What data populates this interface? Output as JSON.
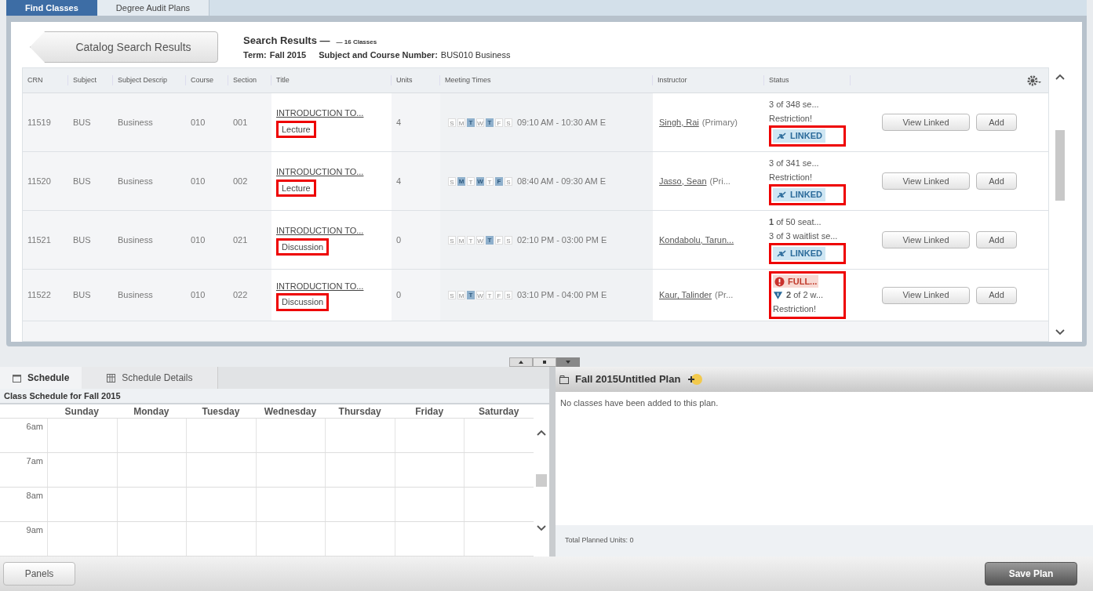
{
  "top_tabs": [
    {
      "label": "Find Classes",
      "selected": true
    },
    {
      "label": "Degree Audit Plans",
      "selected": false
    }
  ],
  "back_button": "Catalog Search Results",
  "results": {
    "title": "Search Results —",
    "count": "— 16 Classes",
    "term_label": "Term:",
    "term": "Fall 2015",
    "subject_label": "Subject and Course Number:",
    "subject": "BUS010 Business"
  },
  "table": {
    "columns": [
      "CRN",
      "Subject",
      "Subject Descrip",
      "Course",
      "Section",
      "Title",
      "Units",
      "Meeting Times",
      "Instructor",
      "Status"
    ],
    "rows": [
      {
        "crn": "11519",
        "subject": "BUS",
        "description": "Business",
        "course": "010",
        "section": "001",
        "title": "INTRODUCTION TO...",
        "type": {
          "text": "Lecture",
          "boxed": true
        },
        "units": "4",
        "days": [
          {
            "letter": "S",
            "selected": false
          },
          {
            "letter": "M",
            "selected": false
          },
          {
            "letter": "T",
            "selected": true
          },
          {
            "letter": "W",
            "selected": false
          },
          {
            "letter": "T",
            "selected": true
          },
          {
            "letter": "F",
            "selected": false
          },
          {
            "letter": "S",
            "selected": false
          }
        ],
        "time": "09:10 AM - 10:30 AM E",
        "instructor": "Singh, Rai",
        "instructor_role": "(Primary)",
        "status": {
          "plain": [
            {
              "kind": "text",
              "text": "3 of 348 se..."
            },
            {
              "kind": "text",
              "text": "Restriction!"
            }
          ],
          "boxed": [
            {
              "kind": "linked",
              "text": "LINKED"
            }
          ]
        },
        "actions": [
          "View Linked",
          "Add"
        ]
      },
      {
        "crn": "11520",
        "subject": "BUS",
        "description": "Business",
        "course": "010",
        "section": "002",
        "title": "INTRODUCTION TO...",
        "type": {
          "text": "Lecture",
          "boxed": true
        },
        "units": "4",
        "days": [
          {
            "letter": "S",
            "selected": false
          },
          {
            "letter": "M",
            "selected": true
          },
          {
            "letter": "T",
            "selected": false
          },
          {
            "letter": "W",
            "selected": true
          },
          {
            "letter": "T",
            "selected": false
          },
          {
            "letter": "F",
            "selected": true
          },
          {
            "letter": "S",
            "selected": false
          }
        ],
        "time": "08:40 AM - 09:30 AM E",
        "instructor": "Jasso, Sean",
        "instructor_role": "(Pri...",
        "status": {
          "plain": [
            {
              "kind": "text",
              "text": "3 of 341 se..."
            },
            {
              "kind": "text",
              "text": "Restriction!"
            }
          ],
          "boxed": [
            {
              "kind": "linked",
              "text": "LINKED"
            }
          ]
        },
        "actions": [
          "View Linked",
          "Add"
        ]
      },
      {
        "crn": "11521",
        "subject": "BUS",
        "description": "Business",
        "course": "010",
        "section": "021",
        "title": "INTRODUCTION TO...",
        "type": {
          "text": "Discussion",
          "boxed": true
        },
        "units": "0",
        "days": [
          {
            "letter": "S",
            "selected": false
          },
          {
            "letter": "M",
            "selected": false
          },
          {
            "letter": "T",
            "selected": false
          },
          {
            "letter": "W",
            "selected": false
          },
          {
            "letter": "T",
            "selected": true
          },
          {
            "letter": "F",
            "selected": false
          },
          {
            "letter": "S",
            "selected": false
          }
        ],
        "time": "02:10 PM - 03:00 PM E",
        "instructor": "Kondabolu, Tarun...",
        "status": {
          "plain": [
            {
              "kind": "text",
              "text": "**1** of 50 seat..."
            },
            {
              "kind": "text",
              "text": "3 of 3 waitlist se..."
            }
          ],
          "boxed": [
            {
              "kind": "linked",
              "text": "LINKED"
            }
          ]
        },
        "actions": [
          "View Linked",
          "Add"
        ]
      },
      {
        "crn": "11522",
        "subject": "BUS",
        "description": "Business",
        "course": "010",
        "section": "022",
        "title": "INTRODUCTION TO...",
        "type": {
          "text": "Discussion",
          "boxed": true
        },
        "units": "0",
        "days": [
          {
            "letter": "S",
            "selected": false
          },
          {
            "letter": "M",
            "selected": false
          },
          {
            "letter": "T",
            "selected": true
          },
          {
            "letter": "W",
            "selected": false
          },
          {
            "letter": "T",
            "selected": false
          },
          {
            "letter": "F",
            "selected": false
          },
          {
            "letter": "S",
            "selected": false
          }
        ],
        "time": "03:10 PM - 04:00 PM E",
        "instructor": "Kaur, Talinder",
        "instructor_role": "(Pr...",
        "status": {
          "boxed": [
            {
              "kind": "full",
              "text": "FULL..."
            },
            {
              "kind": "waitlist",
              "text": "**2** of 2 w..."
            },
            {
              "kind": "text",
              "text": "Restriction!"
            }
          ]
        },
        "actions": [
          "View Linked",
          "Add"
        ]
      }
    ]
  },
  "schedule": {
    "tabs": [
      {
        "label": "Schedule",
        "selected": true
      },
      {
        "label": "Schedule Details",
        "selected": false
      }
    ],
    "title": "Class Schedule for Fall 2015",
    "days": [
      "Sunday",
      "Monday",
      "Tuesday",
      "Wednesday",
      "Thursday",
      "Friday",
      "Saturday"
    ],
    "hours": [
      "6am",
      "7am",
      "8am",
      "9am"
    ]
  },
  "plan": {
    "title": "Fall 2015Untitled Plan",
    "empty_message": "No classes have been added to this plan.",
    "total": "Total Planned Units: 0"
  },
  "footer": {
    "panels_button": "Panels",
    "save_button": "Save Plan"
  }
}
